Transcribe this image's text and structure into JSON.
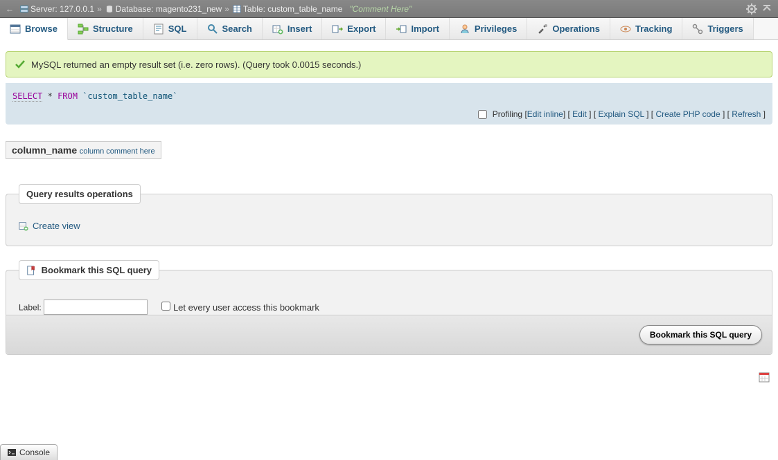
{
  "breadcrumb": {
    "server_label": "Server:",
    "server_value": "127.0.0.1",
    "database_label": "Database:",
    "database_value": "magento231_new",
    "table_label": "Table:",
    "table_value": "custom_table_name",
    "comment": "\"Comment Here\""
  },
  "tabs": {
    "browse": "Browse",
    "structure": "Structure",
    "sql": "SQL",
    "search": "Search",
    "insert": "Insert",
    "export": "Export",
    "import": "Import",
    "privileges": "Privileges",
    "operations": "Operations",
    "tracking": "Tracking",
    "triggers": "Triggers"
  },
  "success_message": "MySQL returned an empty result set (i.e. zero rows). (Query took 0.0015 seconds.)",
  "sql": {
    "select": "SELECT",
    "star": "*",
    "from": "FROM",
    "table": "`custom_table_name`"
  },
  "sql_actions": {
    "profiling": "Profiling",
    "edit_inline": "Edit inline",
    "edit": "Edit",
    "explain": "Explain SQL",
    "create_php": "Create PHP code",
    "refresh": "Refresh"
  },
  "column": {
    "name": "column_name",
    "comment": "column comment here"
  },
  "ops_fieldset": {
    "legend": "Query results operations",
    "create_view": "Create view"
  },
  "bookmark_fieldset": {
    "legend": "Bookmark this SQL query",
    "label_text": "Label:",
    "share_text": "Let every user access this bookmark",
    "button": "Bookmark this SQL query"
  },
  "console": "Console"
}
